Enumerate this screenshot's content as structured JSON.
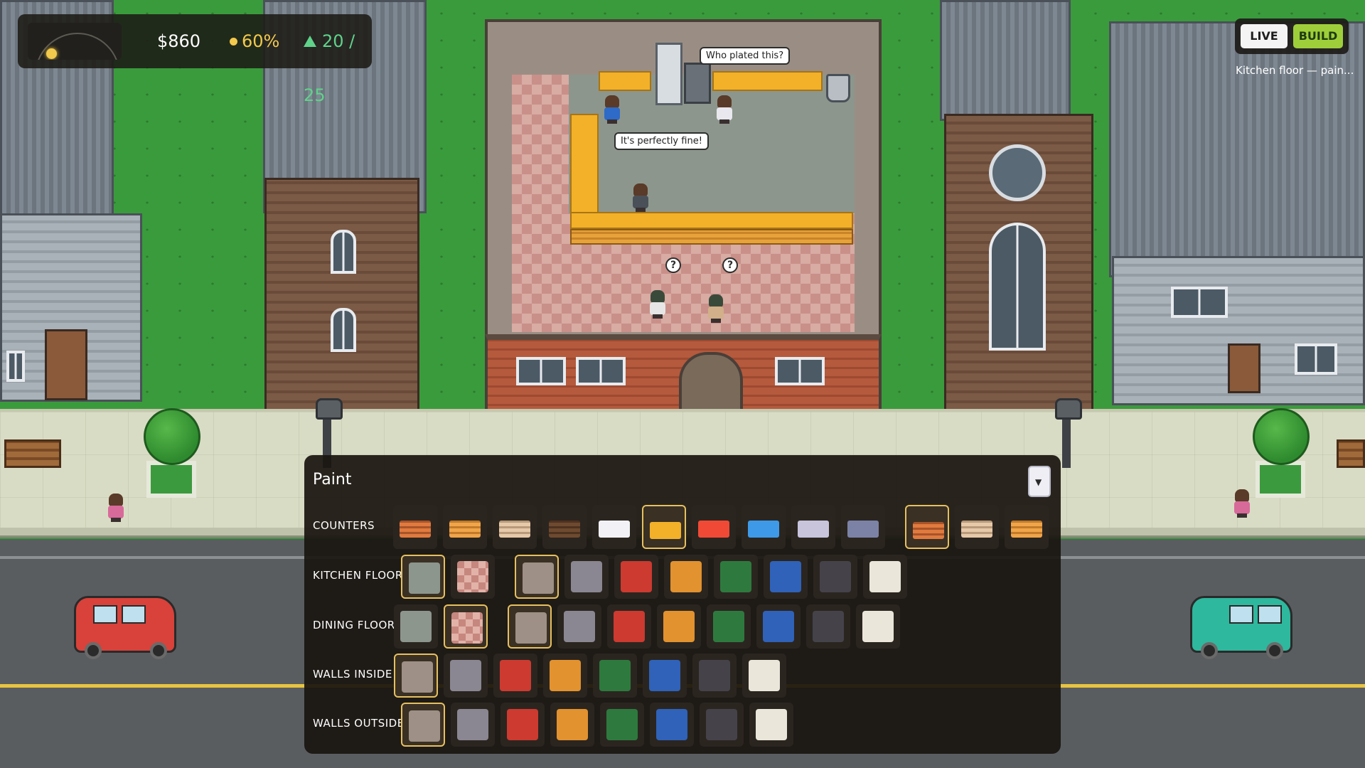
{
  "hud": {
    "money": "$860",
    "rating": "60%",
    "guests": "20 / 25"
  },
  "mode": {
    "live_label": "LIVE",
    "build_label": "BUILD",
    "active": "build",
    "status": "Kitchen floor — pain..."
  },
  "speech": {
    "left": "It's perfectly fine!",
    "right": "Who plated this?"
  },
  "panel": {
    "title": "Paint",
    "rows": [
      {
        "label": "COUNTERS",
        "swatches": [
          {
            "fill": "wood1",
            "selected": false
          },
          {
            "fill": "wood2",
            "selected": false
          },
          {
            "fill": "wood3",
            "selected": false
          },
          {
            "fill": "wood4",
            "selected": false
          },
          {
            "fill": "#f2f2f6",
            "selected": false
          },
          {
            "fill": "#f2b129",
            "selected": true
          },
          {
            "fill": "#f04a36",
            "selected": false
          },
          {
            "fill": "#3e9ae8",
            "selected": false
          },
          {
            "fill": "#c7c4dc",
            "selected": false
          },
          {
            "fill": "#7c82a6",
            "selected": false
          }
        ],
        "front_swatches": [
          {
            "fill": "wood1",
            "selected": true
          },
          {
            "fill": "wood3",
            "selected": false
          },
          {
            "fill": "wood2",
            "selected": false
          }
        ]
      },
      {
        "label": "KITCHEN FLOOR",
        "pattern_swatches": [
          {
            "fill": "#8d968d",
            "selected": true
          },
          {
            "fill": "pattern",
            "selected": false
          }
        ],
        "swatches": [
          {
            "fill": "#9e9086",
            "selected": true
          },
          {
            "fill": "#8a8692",
            "selected": false
          },
          {
            "fill": "#cc3a30",
            "selected": false
          },
          {
            "fill": "#e2922e",
            "selected": false
          },
          {
            "fill": "#2e7a3e",
            "selected": false
          },
          {
            "fill": "#2f62b8",
            "selected": false
          },
          {
            "fill": "#45424a",
            "selected": false
          },
          {
            "fill": "#ebe6da",
            "selected": false
          }
        ]
      },
      {
        "label": "DINING FLOOR",
        "pattern_swatches": [
          {
            "fill": "#8d968d",
            "selected": false
          },
          {
            "fill": "pattern",
            "selected": true
          }
        ],
        "swatches": [
          {
            "fill": "#9e9086",
            "selected": true
          },
          {
            "fill": "#8a8692",
            "selected": false
          },
          {
            "fill": "#cc3a30",
            "selected": false
          },
          {
            "fill": "#e2922e",
            "selected": false
          },
          {
            "fill": "#2e7a3e",
            "selected": false
          },
          {
            "fill": "#2f62b8",
            "selected": false
          },
          {
            "fill": "#45424a",
            "selected": false
          },
          {
            "fill": "#ebe6da",
            "selected": false
          }
        ]
      },
      {
        "label": "WALLS INSIDE",
        "swatches": [
          {
            "fill": "#9e9086",
            "selected": true
          },
          {
            "fill": "#8a8692",
            "selected": false
          },
          {
            "fill": "#cc3a30",
            "selected": false
          },
          {
            "fill": "#e2922e",
            "selected": false
          },
          {
            "fill": "#2e7a3e",
            "selected": false
          },
          {
            "fill": "#2f62b8",
            "selected": false
          },
          {
            "fill": "#45424a",
            "selected": false
          },
          {
            "fill": "#ebe6da",
            "selected": false
          }
        ]
      },
      {
        "label": "WALLS OUTSIDE",
        "swatches": [
          {
            "fill": "#9e9086",
            "selected": true
          },
          {
            "fill": "#8a8692",
            "selected": false
          },
          {
            "fill": "#cc3a30",
            "selected": false
          },
          {
            "fill": "#e2922e",
            "selected": false
          },
          {
            "fill": "#2e7a3e",
            "selected": false
          },
          {
            "fill": "#2f62b8",
            "selected": false
          },
          {
            "fill": "#45424a",
            "selected": false
          },
          {
            "fill": "#ebe6da",
            "selected": false
          }
        ]
      }
    ]
  },
  "colors": {
    "accent_selected": "#e6c060",
    "build_active": "#9ecf3a",
    "guests_green": "#5fd38a",
    "rating_yellow": "#f2c94c"
  },
  "icons": {
    "rating": "dot-icon",
    "guests": "triangle-up-icon",
    "collapse": "chevron-down-icon",
    "time": "sun-icon"
  }
}
